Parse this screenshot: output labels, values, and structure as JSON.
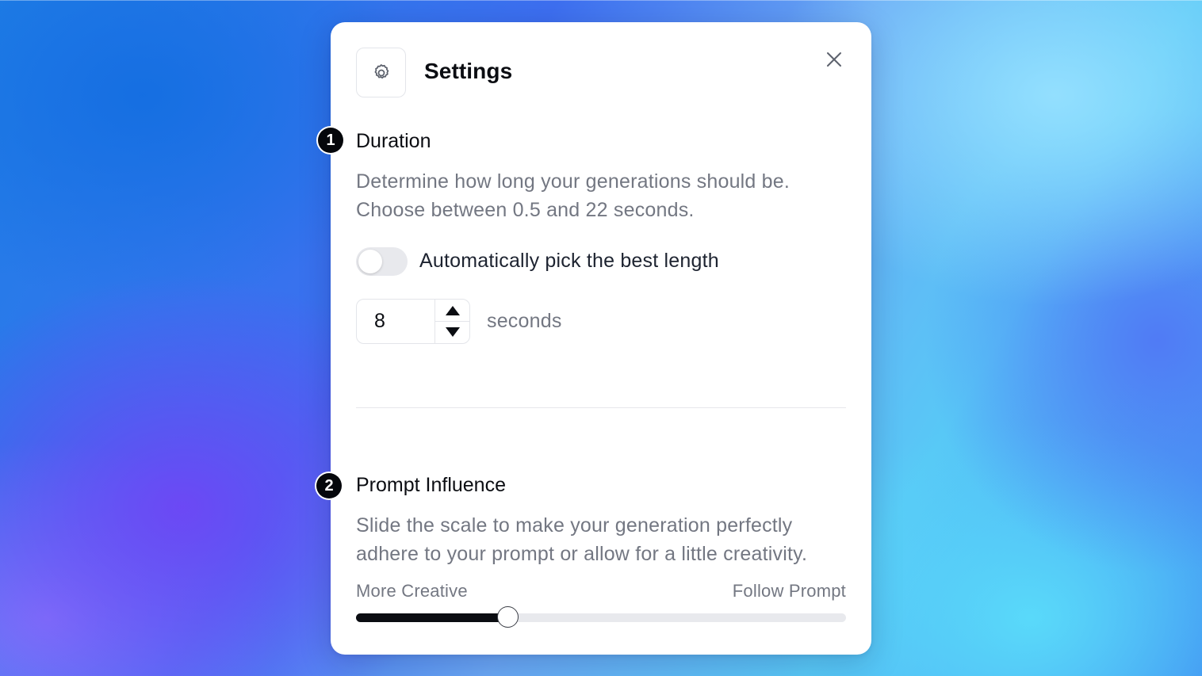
{
  "dialog": {
    "title": "Settings",
    "header_icon": "gear-icon",
    "close_icon": "close-icon"
  },
  "duration": {
    "step": "1",
    "title": "Duration",
    "description": "Determine how long your generations should be. Choose between 0.5 and 22 seconds.",
    "auto_toggle": {
      "label": "Automatically pick the best length",
      "enabled": false
    },
    "value": "8",
    "unit": "seconds",
    "stepper_up_icon": "triangle-up-icon",
    "stepper_down_icon": "triangle-down-icon"
  },
  "prompt_influence": {
    "step": "2",
    "title": "Prompt Influence",
    "description": "Slide the scale to make your generation perfectly adhere to your prompt or allow for a little creativity.",
    "min_label": "More Creative",
    "max_label": "Follow Prompt",
    "value": 0.31
  },
  "colors": {
    "accent": "#0b0d12",
    "muted_text": "#737782",
    "track": "#e8e9ed"
  }
}
